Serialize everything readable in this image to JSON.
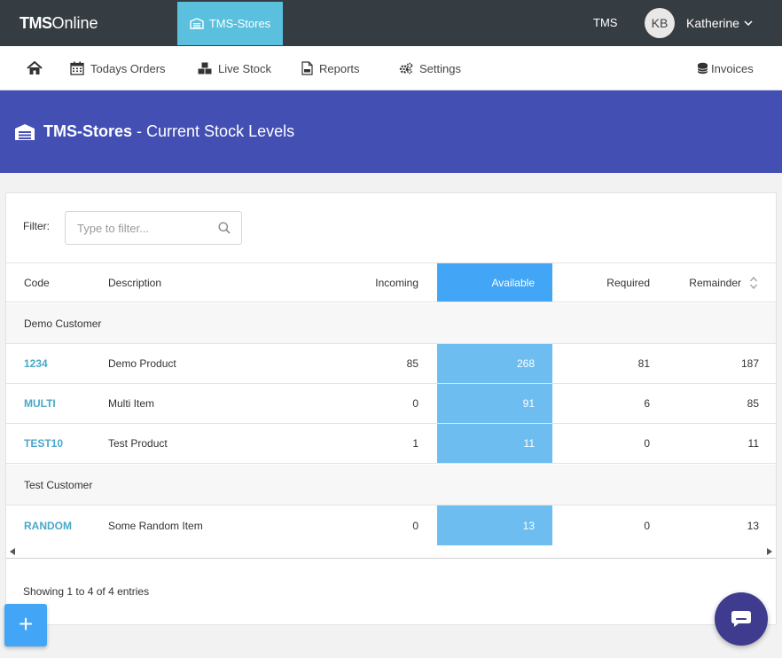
{
  "topbar": {
    "brand_bold": "TMS",
    "brand_light": "Online",
    "app_tab": "TMS-Stores",
    "tms_label": "TMS",
    "avatar_initials": "KB",
    "username": "Katherine"
  },
  "nav": {
    "home_icon": "home-icon",
    "todays_orders": "Todays Orders",
    "live_stock": "Live Stock",
    "reports": "Reports",
    "settings": "Settings",
    "invoices": "Invoices"
  },
  "banner": {
    "title_bold": "TMS-Stores",
    "title_rest": "- Current Stock Levels"
  },
  "filter": {
    "label": "Filter:",
    "placeholder": "Type to filter..."
  },
  "table": {
    "headers": {
      "code": "Code",
      "description": "Description",
      "incoming": "Incoming",
      "available": "Available",
      "required": "Required",
      "remainder": "Remainder"
    },
    "groups": [
      {
        "name": "Demo Customer",
        "rows": [
          {
            "code": "1234",
            "description": "Demo Product",
            "incoming": "85",
            "available": "268",
            "required": "81",
            "remainder": "187"
          },
          {
            "code": "MULTI",
            "description": "Multi Item",
            "incoming": "0",
            "available": "91",
            "required": "6",
            "remainder": "85"
          },
          {
            "code": "TEST10",
            "description": "Test Product",
            "incoming": "1",
            "available": "11",
            "required": "0",
            "remainder": "11"
          }
        ]
      },
      {
        "name": "Test Customer",
        "rows": [
          {
            "code": "RANDOM",
            "description": "Some Random Item",
            "incoming": "0",
            "available": "13",
            "required": "0",
            "remainder": "13"
          }
        ]
      }
    ]
  },
  "footer": {
    "showing": "Showing 1 to 4 of 4 entries",
    "add_label": "+"
  },
  "colors": {
    "topbar": "#353c42",
    "app_tab": "#5bc0de",
    "banner": "#434fb3",
    "available_header": "#42a5f5",
    "available_cell": "#6ebdf1",
    "link": "#4aa8c8",
    "chat": "#3f3b8f"
  }
}
